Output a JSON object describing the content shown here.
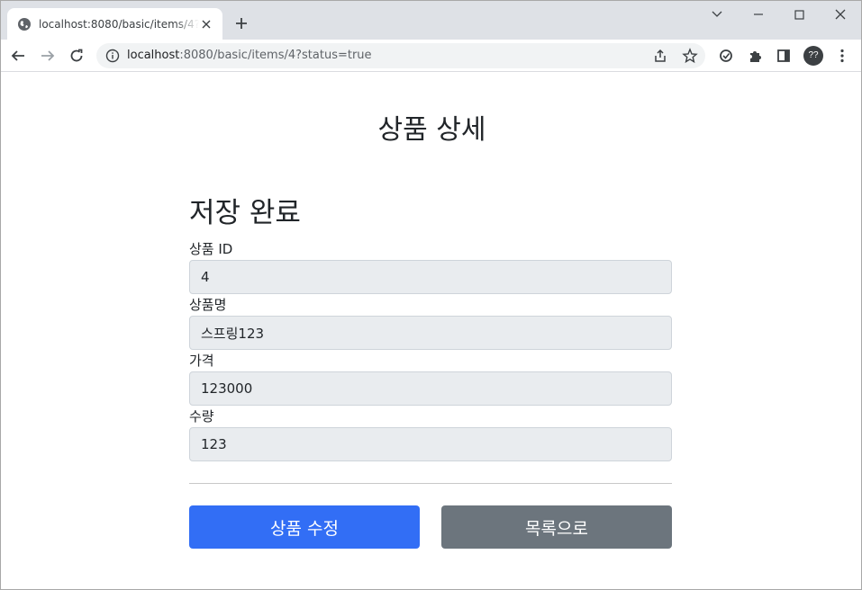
{
  "browser": {
    "tab_title": "localhost:8080/basic/items/4?status=true",
    "url_host": "localhost",
    "url_rest": ":8080/basic/items/4?status=true",
    "avatar_text": "??",
    "icons": [
      "globe-icon",
      "close-icon",
      "plus-icon",
      "chevron-down-icon",
      "minimize-icon",
      "maximize-icon",
      "window-close-icon",
      "back-arrow-icon",
      "forward-arrow-icon",
      "reload-icon",
      "info-icon",
      "share-icon",
      "star-icon",
      "sync-icon",
      "extensions-puzzle-icon",
      "side-panel-icon",
      "kebab-menu-icon"
    ]
  },
  "page": {
    "title": "상품 상세",
    "alert": "저장 완료",
    "fields": [
      {
        "label": "상품 ID",
        "value": "4"
      },
      {
        "label": "상품명",
        "value": "스프링123"
      },
      {
        "label": "가격",
        "value": "123000"
      },
      {
        "label": "수량",
        "value": "123"
      }
    ],
    "buttons": {
      "edit": "상품 수정",
      "list": "목록으로"
    }
  },
  "colors": {
    "primary": "#326ef5",
    "secondary": "#6c757d",
    "input_bg": "#e9ecef"
  }
}
